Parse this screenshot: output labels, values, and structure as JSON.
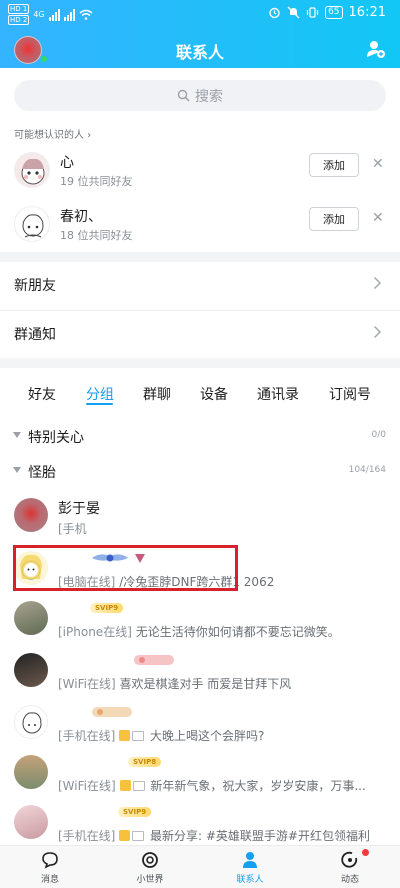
{
  "status": {
    "time": "16:21",
    "battery": "65",
    "sim1": "HD 1",
    "sim2": "HD 2",
    "network": "4G"
  },
  "header": {
    "title": "联系人"
  },
  "search": {
    "placeholder": "搜索"
  },
  "recommend": {
    "label": "可能想认识的人 ›",
    "items": [
      {
        "name": "心",
        "mutual": "19 位共同好友",
        "add_label": "添加"
      },
      {
        "name": "春初、",
        "mutual": "18 位共同好友",
        "add_label": "添加"
      }
    ]
  },
  "entries": {
    "new_friends": "新朋友",
    "group_notice": "群通知"
  },
  "tabs": [
    "好友",
    "分组",
    "群聊",
    "设备",
    "通讯录",
    "订阅号"
  ],
  "groups": [
    {
      "name": "特别关心",
      "count": "0/0"
    },
    {
      "name": "怪胎",
      "count": "104/164"
    }
  ],
  "friends": [
    {
      "name": "彭于晏",
      "status": "[手机",
      "rest": ""
    },
    {
      "name": "",
      "status": "[电脑在线]",
      "rest": " /冷兔歪脖DNF跨六群1 2062"
    },
    {
      "name": "",
      "status": "[iPhone在线]",
      "rest": " 无论生活待你如何请都不要忘记微笑。"
    },
    {
      "name": "",
      "status": "[WiFi在线]",
      "rest": " 喜欢是棋逢对手 而爱是甘拜下风"
    },
    {
      "name": "",
      "status": "[手机在线]",
      "rest": " 大晚上喝这个会胖吗?"
    },
    {
      "name": "",
      "status": "[WiFi在线]",
      "rest": " 新年新气象，祝大家，岁岁安康，万事..."
    },
    {
      "name": "",
      "status": "[手机在线]",
      "rest": " 最新分享: #英雄联盟手游#开红包领福利"
    }
  ],
  "badges": {
    "svip9": "SVIP9",
    "svip8": "SVIP8"
  },
  "bottom_nav": [
    "消息",
    "小世界",
    "联系人",
    "动态"
  ],
  "colors": {
    "accent": "#12a0ef",
    "header_start": "#35b3ff",
    "highlight_box": "#d6222b"
  }
}
